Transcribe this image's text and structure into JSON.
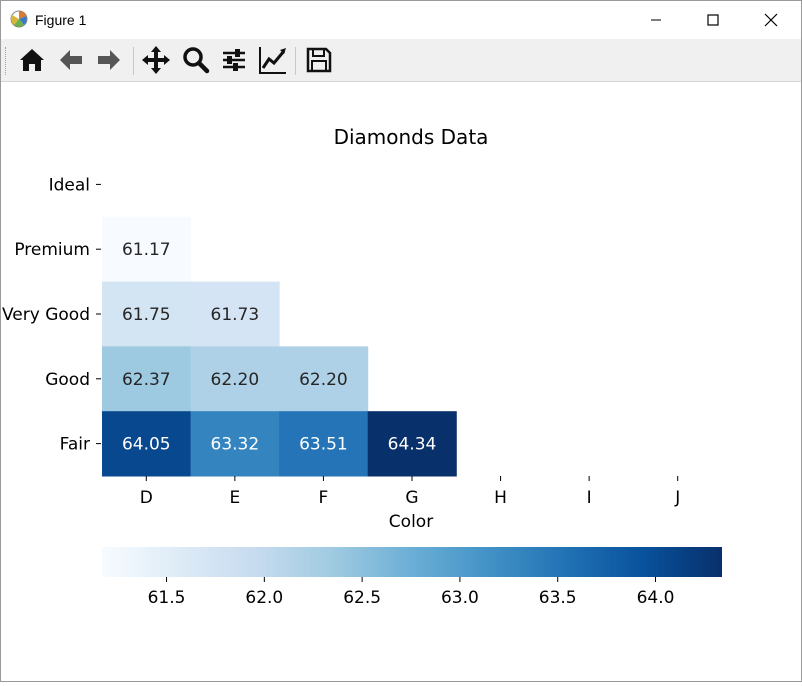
{
  "window": {
    "title": "Figure 1"
  },
  "toolbar": {
    "buttons": [
      {
        "name": "home-icon"
      },
      {
        "name": "back-arrow-icon"
      },
      {
        "name": "forward-arrow-icon"
      },
      {
        "name": "pan-icon"
      },
      {
        "name": "zoom-icon"
      },
      {
        "name": "configure-subplots-icon"
      },
      {
        "name": "edit-axis-icon"
      },
      {
        "name": "save-icon"
      }
    ]
  },
  "chart_data": {
    "type": "heatmap",
    "title": "Diamonds Data",
    "xlabel": "Color",
    "ylabel": "",
    "x_categories": [
      "D",
      "E",
      "F",
      "G",
      "H",
      "I",
      "J"
    ],
    "y_categories": [
      "Ideal",
      "Premium",
      "Very Good",
      "Good",
      "Fair"
    ],
    "cells": [
      {
        "row": "Premium",
        "col": "D",
        "value": 61.17,
        "label": "61.17"
      },
      {
        "row": "Very Good",
        "col": "D",
        "value": 61.75,
        "label": "61.75"
      },
      {
        "row": "Very Good",
        "col": "E",
        "value": 61.73,
        "label": "61.73"
      },
      {
        "row": "Good",
        "col": "D",
        "value": 62.37,
        "label": "62.37"
      },
      {
        "row": "Good",
        "col": "E",
        "value": 62.2,
        "label": "62.20"
      },
      {
        "row": "Good",
        "col": "F",
        "value": 62.2,
        "label": "62.20"
      },
      {
        "row": "Fair",
        "col": "D",
        "value": 64.05,
        "label": "64.05"
      },
      {
        "row": "Fair",
        "col": "E",
        "value": 63.32,
        "label": "63.32"
      },
      {
        "row": "Fair",
        "col": "F",
        "value": 63.51,
        "label": "63.51"
      },
      {
        "row": "Fair",
        "col": "G",
        "value": 64.34,
        "label": "64.34"
      }
    ],
    "colormap": "Blues",
    "colorbar": {
      "orientation": "horizontal",
      "range": [
        61.17,
        64.34
      ],
      "ticks": [
        61.5,
        62.0,
        62.5,
        63.0,
        63.5,
        64.0
      ],
      "tick_labels": [
        "61.5",
        "62.0",
        "62.5",
        "63.0",
        "63.5",
        "64.0"
      ]
    },
    "grid": false
  }
}
